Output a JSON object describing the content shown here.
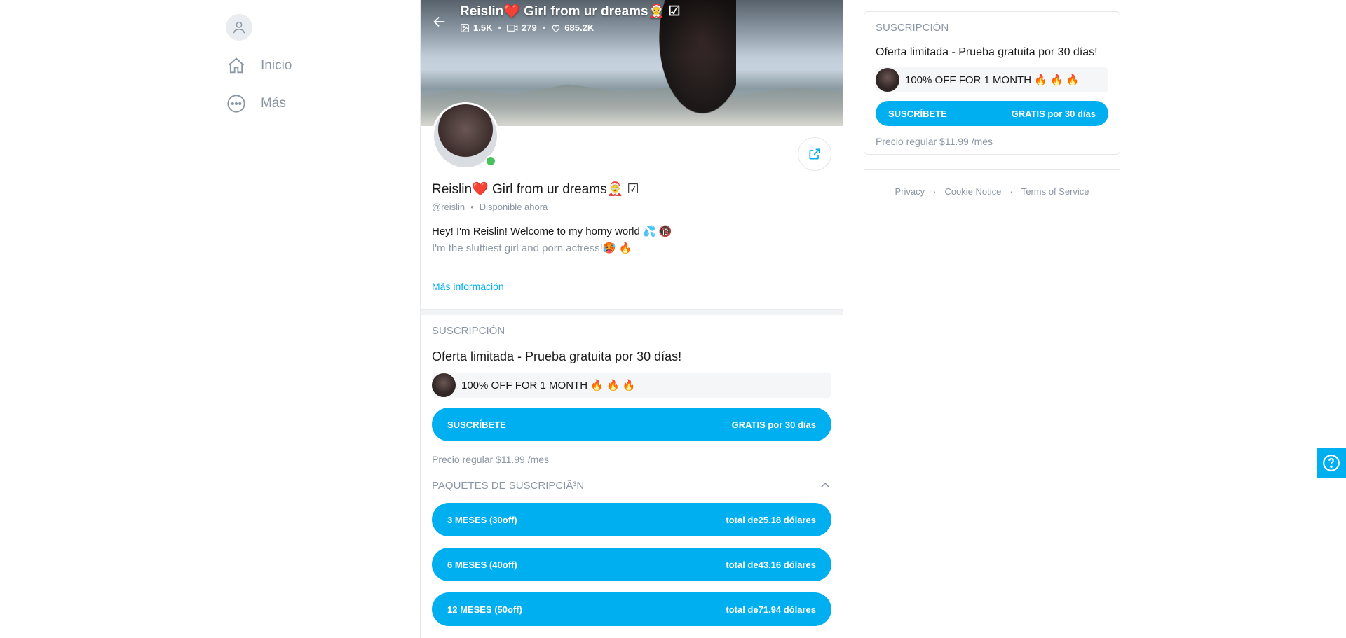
{
  "sidebar": {
    "items": [
      {
        "label": "Inicio",
        "icon": "home-icon"
      },
      {
        "label": "Más",
        "icon": "more-icon"
      }
    ]
  },
  "profile": {
    "cover_title": "Reislin❤️ Girl from ur dreams🤶 ☑",
    "stats": {
      "photos": "1.5K",
      "videos": "279",
      "likes": "685.2K"
    },
    "name": "Reislin❤️ Girl from ur dreams🤶 ☑",
    "handle": "@reislin",
    "status": "Disponible ahora",
    "bio_line1": "Hey! I'm Reislin! Welcome to my horny world 💦 🔞",
    "bio_line2": "I'm the sluttiest girl and porn actress!🥵 🔥",
    "more_info": "Más información"
  },
  "subscription": {
    "label": "SUSCRIPCIÓN",
    "offer_title": "Oferta limitada - Prueba gratuita por 30 días!",
    "offer_text": "100% OFF FOR 1 MONTH 🔥 🔥 🔥",
    "button_left": "SUSCRÍBETE",
    "button_right": "GRATIS por 30 días",
    "regular_price": "Precio regular $11.99 /mes"
  },
  "bundles": {
    "label": "PAQUETES DE SUSCRIPCIÃ³N",
    "items": [
      {
        "left": "3 MESES (30off)",
        "right": "total de25.18 dólares"
      },
      {
        "left": "6 MESES (40off)",
        "right": "total de43.16 dólares"
      },
      {
        "left": "12 MESES (50off)",
        "right": "total de71.94 dólares"
      }
    ]
  },
  "footer": {
    "privacy": "Privacy",
    "cookie": "Cookie Notice",
    "terms": "Terms of Service"
  },
  "colors": {
    "accent": "#00aff0",
    "online": "#46c35b",
    "muted": "#8a96a3"
  }
}
